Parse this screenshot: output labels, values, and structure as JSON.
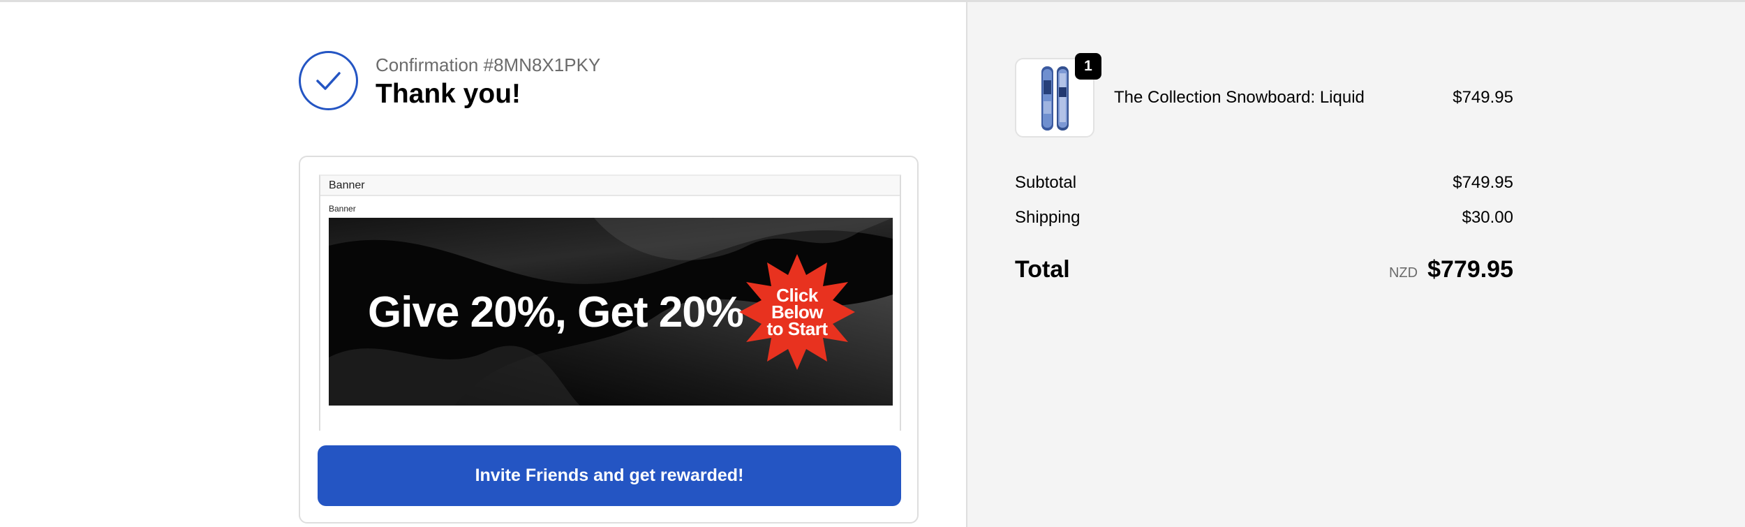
{
  "confirmation": {
    "number_text": "Confirmation #8MN8X1PKY",
    "title": "Thank you!"
  },
  "banner_block": {
    "frame_title": "Banner",
    "inner_label": "Banner",
    "headline": "Give 20%, Get 20%",
    "starburst_text": "Click\nBelow\nto Start",
    "starburst_color": "#e8321f"
  },
  "invite_button": {
    "label": "Invite Friends and get rewarded!"
  },
  "order_summary": {
    "product": {
      "name": "The Collection Snowboard: Liquid",
      "price": "$749.95",
      "quantity": "1"
    },
    "subtotal": {
      "label": "Subtotal",
      "value": "$749.95"
    },
    "shipping": {
      "label": "Shipping",
      "value": "$30.00"
    },
    "total": {
      "label": "Total",
      "currency": "NZD",
      "value": "$779.95"
    }
  },
  "colors": {
    "accent": "#2455c3",
    "summary_background": "#f4f4f4"
  }
}
